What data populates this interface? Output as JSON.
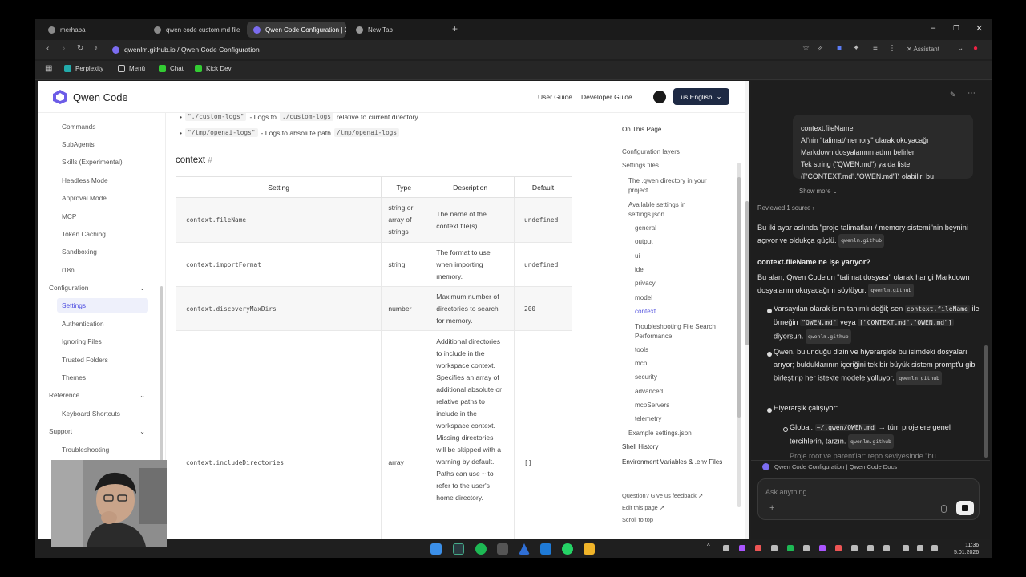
{
  "browser": {
    "tabs": [
      {
        "label": "merhaba"
      },
      {
        "label": "qwen code custom md file"
      },
      {
        "label": "Qwen Code Configuration | Q"
      },
      {
        "label": "New Tab"
      }
    ],
    "url": "qwenlm.github.io / Qwen Code Configuration",
    "bookmarks": [
      "Perplexity",
      "Menü",
      "Chat",
      "Kick Dev"
    ],
    "assistant_label": "Assistant"
  },
  "site": {
    "logo_text": "Qwen Code",
    "nav_links": [
      "User Guide",
      "Developer Guide"
    ],
    "lang_button": "us English"
  },
  "left_nav": {
    "items_top": [
      "Commands",
      "SubAgents",
      "Skills (Experimental)",
      "Headless Mode",
      "Approval Mode",
      "MCP",
      "Token Caching",
      "Sandboxing",
      "i18n"
    ],
    "section_config": "Configuration",
    "config_items": [
      "Settings",
      "Authentication",
      "Ignoring Files",
      "Trusted Folders",
      "Themes"
    ],
    "section_reference": "Reference",
    "reference_items": [
      "Keyboard Shortcuts"
    ],
    "section_support": "Support",
    "support_items": [
      "Troubleshooting"
    ]
  },
  "main": {
    "bullets": [
      {
        "code": "\"./custom-logs\"",
        "text": "- Logs to",
        "code2": "./custom-logs",
        "text2": "relative to current directory"
      },
      {
        "code": "\"/tmp/openai-logs\"",
        "text": "- Logs to absolute path",
        "code2": "/tmp/openai-logs",
        "text2": ""
      }
    ],
    "section_title": "context",
    "anchor": "#",
    "table": {
      "headers": [
        "Setting",
        "Type",
        "Description",
        "Default"
      ],
      "rows": [
        {
          "setting": "context.fileName",
          "type": "string or array of strings",
          "description": "The name of the context file(s).",
          "default": "undefined"
        },
        {
          "setting": "context.importFormat",
          "type": "string",
          "description": "The format to use when importing memory.",
          "default": "undefined"
        },
        {
          "setting": "context.discoveryMaxDirs",
          "type": "number",
          "description": "Maximum number of directories to search for memory.",
          "default": "200"
        },
        {
          "setting": "context.includeDirectories",
          "type": "array",
          "description": "Additional directories to include in the workspace context. Specifies an array of additional absolute or relative paths to include in the workspace context. Missing directories will be skipped with a warning by default. Paths can use ~ to refer to the user's home directory.",
          "default": "[]"
        }
      ]
    }
  },
  "on_this_page": {
    "title": "On This Page",
    "items": [
      {
        "label": "Configuration layers"
      },
      {
        "label": "Settings files"
      },
      {
        "label": "The .qwen directory in your project"
      },
      {
        "label": "Available settings in settings.json"
      },
      {
        "label": "general"
      },
      {
        "label": "output"
      },
      {
        "label": "ui"
      },
      {
        "label": "ide"
      },
      {
        "label": "privacy"
      },
      {
        "label": "model"
      },
      {
        "label": "context"
      },
      {
        "label": "Troubleshooting File Search Performance"
      },
      {
        "label": "tools"
      },
      {
        "label": "mcp"
      },
      {
        "label": "security"
      },
      {
        "label": "advanced"
      },
      {
        "label": "mcpServers"
      },
      {
        "label": "telemetry"
      },
      {
        "label": "Example settings.json"
      },
      {
        "label": "Shell History"
      },
      {
        "label": "Environment Variables & .env Files"
      }
    ],
    "footer_links": [
      "Question? Give us feedback ↗",
      "Edit this page ↗",
      "Scroll to top"
    ]
  },
  "assistant": {
    "quote_lines": [
      "context.fileName",
      "AI'nin \"talimat/memory\" olarak okuyacağı",
      "Markdown dosyalarının adını belirler.",
      "Tek string (\"QWEN.md\") ya da liste",
      "([\"CONTEXT.md\",\"QWEN.md\"]) olabilir; bu"
    ],
    "show_more": "Show more",
    "reviewed": "Reviewed 1 source",
    "para1": "Bu iki ayar aslında \"proje talimatları / memory sistemi\"nin beynini açıyor ve oldukça güçlü.",
    "source_tag": "qwenlm.github",
    "heading1": "context.fileName ne işe yarıyor?",
    "para2": "Bu alan, Qwen Code'un \"talimat dosyası\" olarak hangi Markdown dosyalarını okuyacağını söylüyor.",
    "bullet1_a": "Varsayılan olarak isim tanımlı değil; sen",
    "bullet1_code1": "context.fileName",
    "bullet1_b": "ile örneğin",
    "bullet1_code2": "\"QWEN.md\"",
    "bullet1_c": "veya",
    "bullet1_code3": "[\"CONTEXT.md\",\"QWEN.md\"]",
    "bullet1_d": "diyorsun.",
    "bullet2": "Qwen, bulunduğu dizin ve hiyerarşide bu isimdeki dosyaları arıyor; bulduklarının içeriğini tek bir büyük sistem prompt'u gibi birleştirip her istekte modele yolluyor.",
    "bullet3": "Hiyerarşik çalışıyor:",
    "sub1_a": "Global:",
    "sub1_code": "~/.qwen/QWEN.md",
    "sub1_b": "→ tüm projelere genel tercihlerin, tarzın.",
    "sub2": "Proje root ve parent'lar: repo seviyesinde \"bu",
    "source_bar": "Qwen Code Configuration | Qwen Code Docs",
    "ask_placeholder": "Ask anything..."
  },
  "taskbar": {
    "time": "11:36",
    "date": "5.01.2026"
  }
}
